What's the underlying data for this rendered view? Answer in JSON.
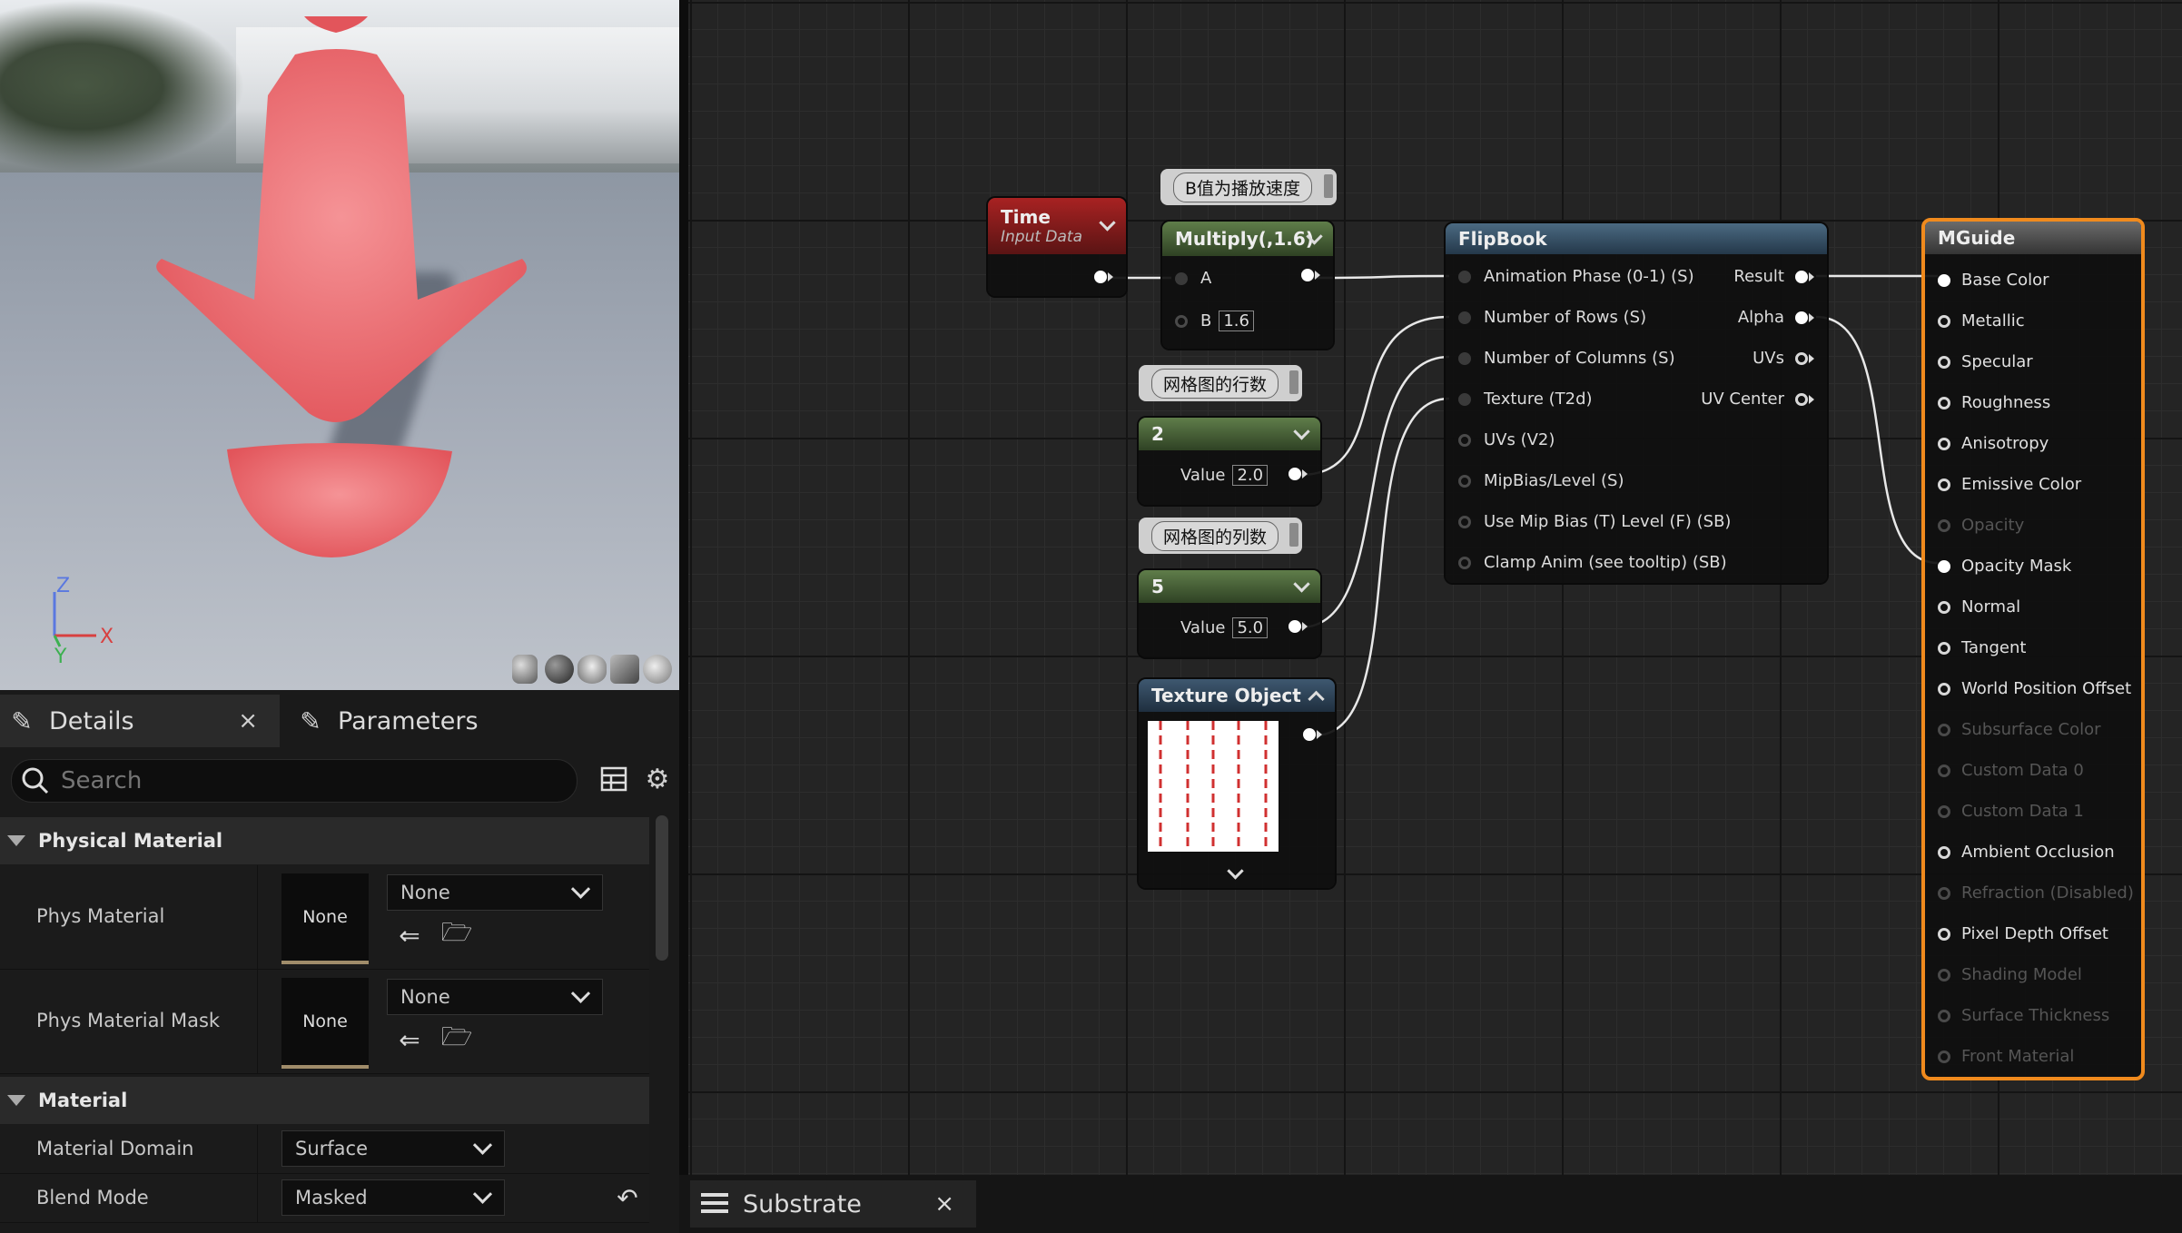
{
  "viewport": {
    "axes": {
      "z": "Z",
      "x": "X",
      "y": "Y"
    },
    "toolbar": [
      "cylinder-icon",
      "sphere-icon",
      "plane-icon",
      "cube-icon",
      "teapot-icon"
    ]
  },
  "details_panel": {
    "tabs": [
      {
        "label": "Details",
        "icon": "pencil-icon",
        "close": "×"
      },
      {
        "label": "Parameters",
        "icon": "pencil-icon"
      }
    ],
    "search": {
      "placeholder": "Search"
    },
    "sections": [
      {
        "title": "Physical Material",
        "rows": [
          {
            "label": "Phys Material",
            "thumb": "None",
            "value": "None"
          },
          {
            "label": "Phys Material Mask",
            "thumb": "None",
            "value": "None"
          }
        ]
      },
      {
        "title": "Material",
        "rows": [
          {
            "label": "Material Domain",
            "value": "Surface"
          },
          {
            "label": "Blend Mode",
            "value": "Masked"
          }
        ]
      }
    ]
  },
  "graph": {
    "time_node": {
      "title": "Time",
      "subtitle": "Input Data"
    },
    "comments": {
      "speed": "B值为播放速度",
      "rows": "网格图的行数",
      "cols": "网格图的列数"
    },
    "multiply_node": {
      "title": "Multiply(,1.6)",
      "pin_a": "A",
      "pin_b": "B",
      "b_value": "1.6"
    },
    "rows_node": {
      "title": "2",
      "label": "Value",
      "value": "2.0"
    },
    "cols_node": {
      "title": "5",
      "label": "Value",
      "value": "5.0"
    },
    "texture_node": {
      "title": "Texture Object"
    },
    "flipbook_node": {
      "title": "FlipBook",
      "inputs": [
        "Animation  Phase (0-1) (S)",
        "Number of Rows (S)",
        "Number of Columns (S)",
        "Texture (T2d)",
        "UVs (V2)",
        "MipBias/Level (S)",
        "Use Mip Bias (T) Level (F) (SB)",
        "Clamp Anim (see tooltip) (SB)"
      ],
      "outputs": [
        "Result",
        "Alpha",
        "UVs",
        "UV Center"
      ]
    },
    "mguide_node": {
      "title": "MGuide",
      "pins": [
        {
          "label": "Base Color",
          "enabled": true,
          "connected": true
        },
        {
          "label": "Metallic",
          "enabled": true
        },
        {
          "label": "Specular",
          "enabled": true
        },
        {
          "label": "Roughness",
          "enabled": true
        },
        {
          "label": "Anisotropy",
          "enabled": true
        },
        {
          "label": "Emissive Color",
          "enabled": true
        },
        {
          "label": "Opacity",
          "enabled": false
        },
        {
          "label": "Opacity Mask",
          "enabled": true,
          "connected": true
        },
        {
          "label": "Normal",
          "enabled": true
        },
        {
          "label": "Tangent",
          "enabled": true
        },
        {
          "label": "World Position Offset",
          "enabled": true
        },
        {
          "label": "Subsurface Color",
          "enabled": false
        },
        {
          "label": "Custom Data 0",
          "enabled": false
        },
        {
          "label": "Custom Data 1",
          "enabled": false
        },
        {
          "label": "Ambient Occlusion",
          "enabled": true
        },
        {
          "label": "Refraction (Disabled)",
          "enabled": false
        },
        {
          "label": "Pixel Depth Offset",
          "enabled": true
        },
        {
          "label": "Shading Model",
          "enabled": false
        },
        {
          "label": "Surface Thickness",
          "enabled": false
        },
        {
          "label": "Front Material",
          "enabled": false
        }
      ]
    }
  },
  "bottom_tab": {
    "label": "Substrate",
    "close": "×"
  },
  "colors": {
    "accent_orange": "#f08a1d",
    "arrow_red": "#e85a5f",
    "time_header": "#8a1c1c",
    "constant_header": "#4a6b2c",
    "flipbook_header": "#3d5468",
    "texture_header": "#2e4256"
  }
}
